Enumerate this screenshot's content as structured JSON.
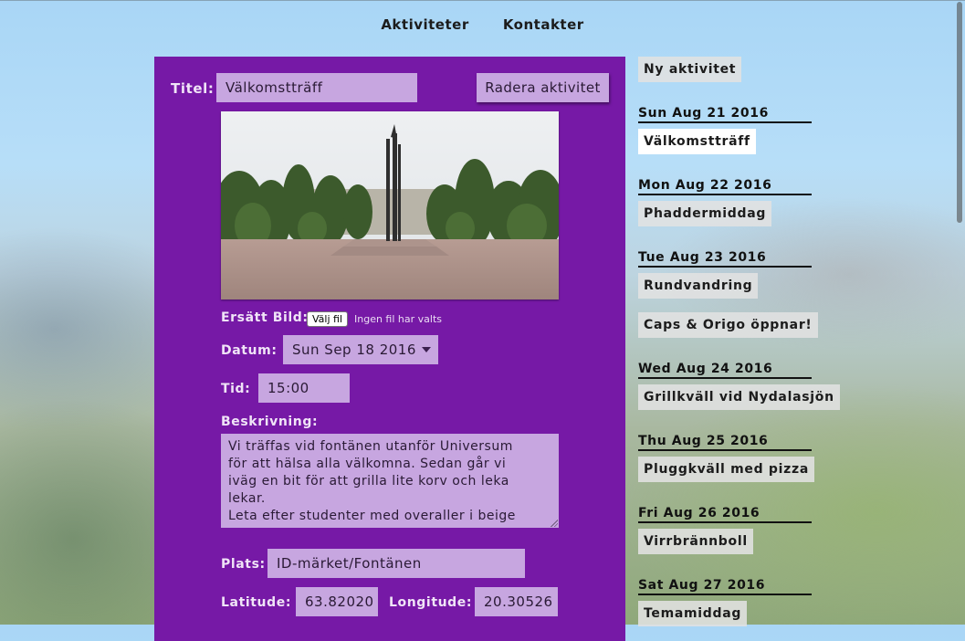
{
  "nav": {
    "items": [
      "Aktiviteter",
      "Kontakter"
    ]
  },
  "form": {
    "title_label": "Titel:",
    "title_value": "Välkomstträff",
    "delete_button": "Radera aktivitet",
    "replace_image_label": "Ersätt Bild:",
    "file_button": "Välj fil",
    "file_status": "Ingen fil har valts",
    "date_label": "Datum:",
    "date_value": "Sun Sep 18 2016",
    "time_label": "Tid:",
    "time_value": "15:00",
    "description_label": "Beskrivning:",
    "description_lines": [
      "Vi träffas vid fontänen utanför Universum",
      "för att hälsa alla välkomna. Sedan går vi",
      "iväg en bit för att grilla lite korv och leka",
      "lekar.",
      "Leta efter studenter med overaller i beige"
    ],
    "place_label": "Plats:",
    "place_value": "ID-märket/Fontänen",
    "latitude_label": "Latitude:",
    "latitude_value": "63.82020",
    "longitude_label": "Longitude:",
    "longitude_value": "20.30526"
  },
  "sidebar": {
    "new_button": "Ny aktivitet",
    "days": [
      {
        "date": "Sun Aug 21 2016",
        "activities": [
          "Välkomstträff"
        ]
      },
      {
        "date": "Mon Aug 22 2016",
        "activities": [
          "Phaddermiddag"
        ]
      },
      {
        "date": "Tue Aug 23 2016",
        "activities": [
          "Rundvandring",
          "Caps & Origo öppnar!"
        ]
      },
      {
        "date": "Wed Aug 24 2016",
        "activities": [
          "Grillkväll vid Nydalasjön"
        ]
      },
      {
        "date": "Thu Aug 25 2016",
        "activities": [
          "Pluggkväll med pizza"
        ]
      },
      {
        "date": "Fri Aug 26 2016",
        "activities": [
          "Virrbrännboll"
        ]
      },
      {
        "date": "Sat Aug 27 2016",
        "activities": [
          "Temamiddag"
        ]
      }
    ]
  },
  "colors": {
    "panel": "#7619a6",
    "field": "#c7a6e0"
  }
}
